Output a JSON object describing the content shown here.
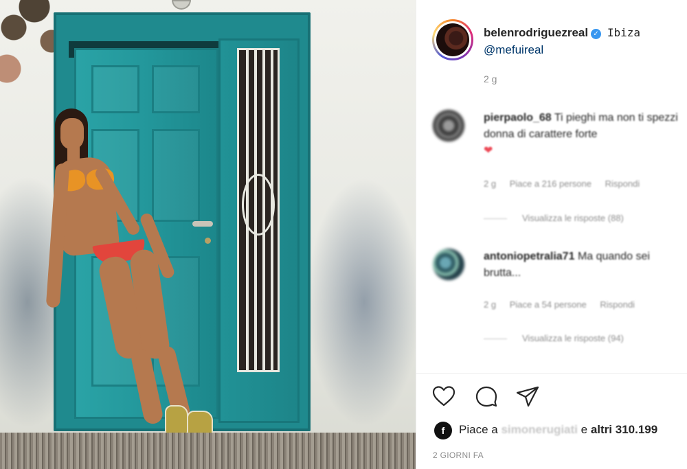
{
  "post": {
    "username": "belenrodriguezreal",
    "verified_icon": "verified-badge-icon",
    "location": "Ibiza",
    "mention": "@mefuireal",
    "time_ago": "2 g"
  },
  "comments": [
    {
      "username": "pierpaolo_68",
      "text": "Ti pieghi ma non ti spezzi donna di carattere forte",
      "emoji": "❤",
      "time": "2 g",
      "likes": "Piace a 216 persone",
      "reply": "Rispondi",
      "view_replies": "Visualizza le risposte (88)"
    },
    {
      "username": "antoniopetralia71",
      "text": "Ma quando sei brutta...",
      "emoji": "",
      "time": "2 g",
      "likes": "Piace a 54 persone",
      "reply": "Rispondi",
      "view_replies": "Visualizza le risposte (94)"
    }
  ],
  "actions": {
    "like_icon": "heart-icon",
    "comment_icon": "comment-icon",
    "share_icon": "share-icon"
  },
  "likes": {
    "prefix": "Piace a",
    "user": "simonerugiati",
    "middle": "e",
    "count": "altri 310.199"
  },
  "date_label": "2 GIORNI FA",
  "colors": {
    "link": "#00376b",
    "muted": "#8e8e8e",
    "verified": "#3897f0",
    "door": "#1f8a8e",
    "heart": "#ed4956"
  }
}
